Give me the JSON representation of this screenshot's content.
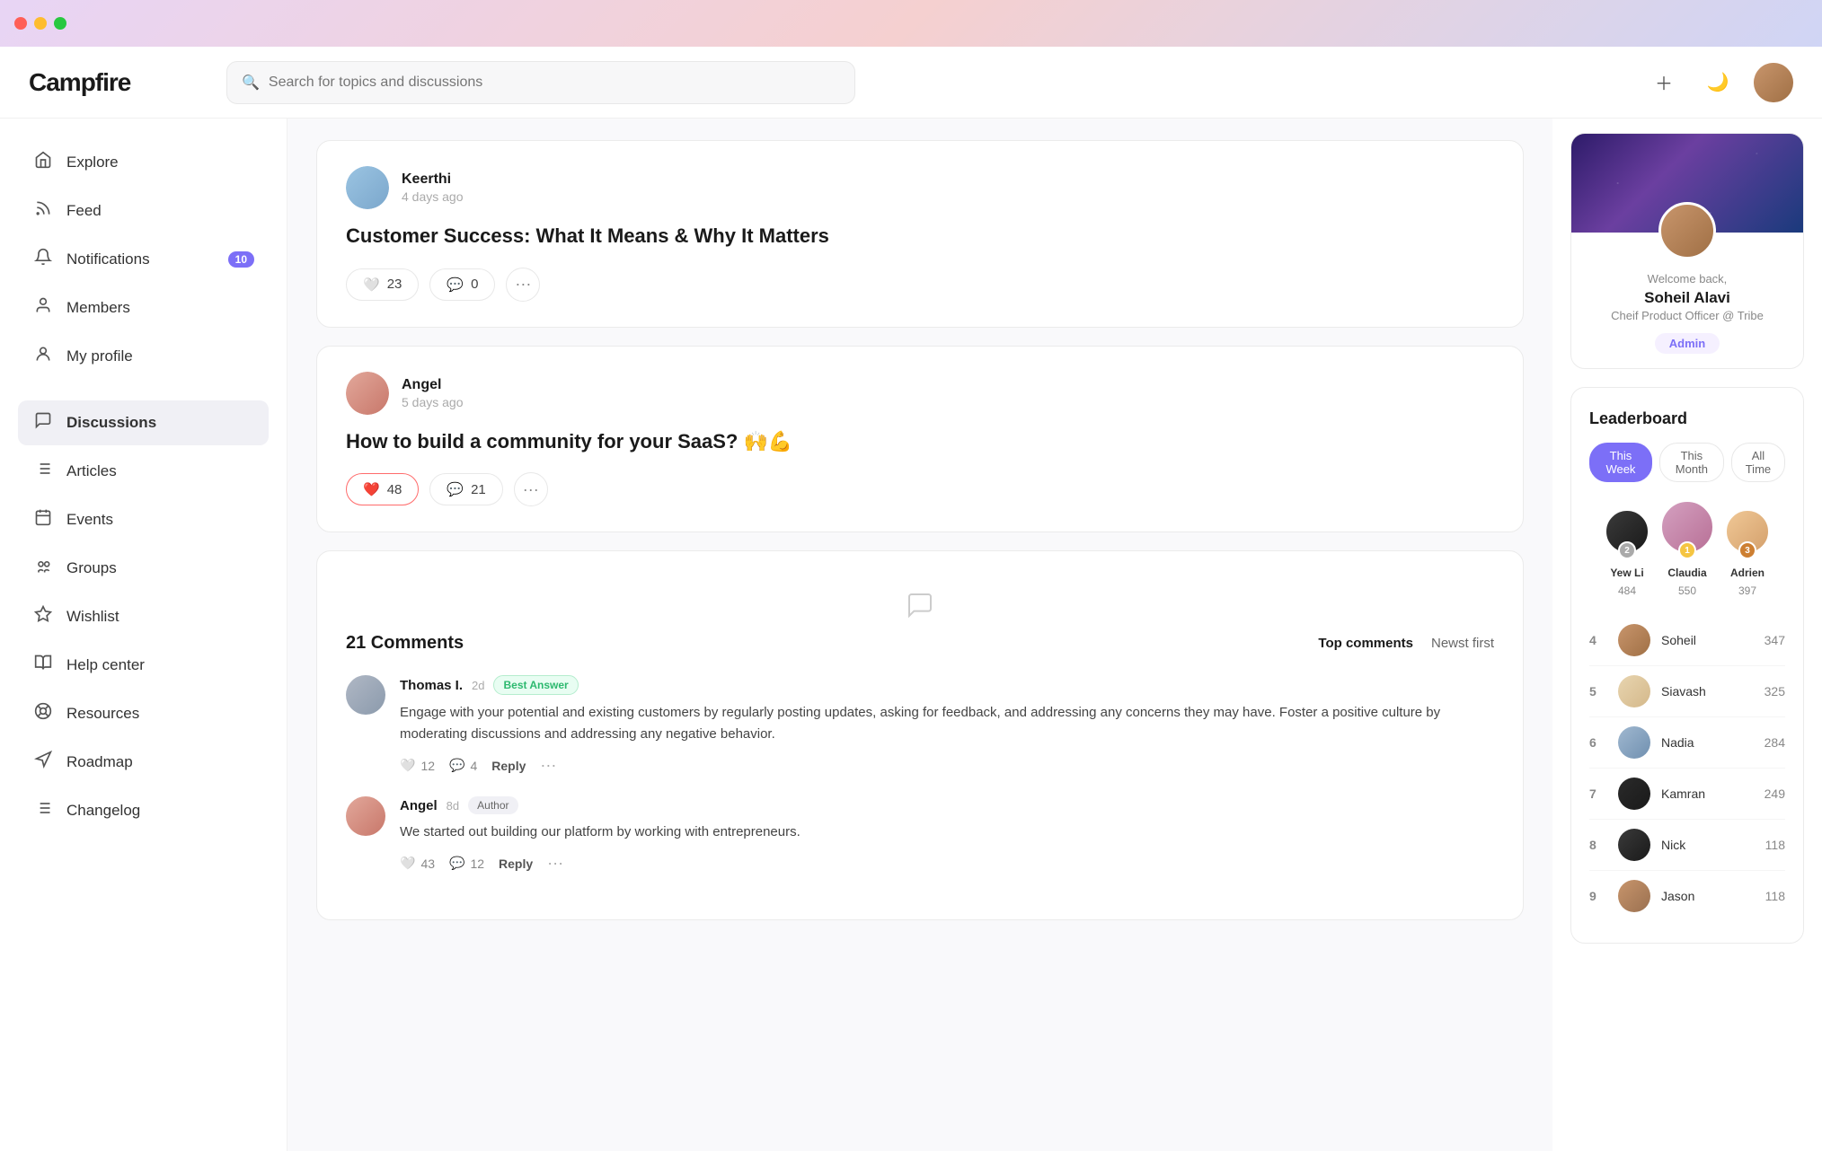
{
  "app": {
    "title": "Campfire",
    "search_placeholder": "Search for topics and discussions"
  },
  "sidebar": {
    "nav_items": [
      {
        "id": "explore",
        "label": "Explore",
        "icon": "🏠"
      },
      {
        "id": "feed",
        "label": "Feed",
        "icon": "📡"
      },
      {
        "id": "notifications",
        "label": "Notifications",
        "icon": "🔔",
        "badge": "10"
      },
      {
        "id": "members",
        "label": "Members",
        "icon": "👤"
      },
      {
        "id": "my-profile",
        "label": "My profile",
        "icon": "👤"
      }
    ],
    "sections": [
      {
        "id": "discussions",
        "label": "Discussions",
        "icon": "💬",
        "active": true
      },
      {
        "id": "articles",
        "label": "Articles",
        "icon": "📋"
      },
      {
        "id": "events",
        "label": "Events",
        "icon": "📅"
      },
      {
        "id": "groups",
        "label": "Groups",
        "icon": "🔗"
      },
      {
        "id": "wishlist",
        "label": "Wishlist",
        "icon": "✨"
      },
      {
        "id": "help-center",
        "label": "Help center",
        "icon": "📖"
      },
      {
        "id": "resources",
        "label": "Resources",
        "icon": "🌐"
      },
      {
        "id": "roadmap",
        "label": "Roadmap",
        "icon": "🗺"
      },
      {
        "id": "changelog",
        "label": "Changelog",
        "icon": "📝"
      }
    ]
  },
  "posts": [
    {
      "id": "post1",
      "author": "Keerthi",
      "time": "4 days ago",
      "title": "Customer Success: What It Means & Why It Matters",
      "likes": 23,
      "comments": 0,
      "liked": false
    },
    {
      "id": "post2",
      "author": "Angel",
      "time": "5 days ago",
      "title": "How to build a community for your SaaS? 🙌💪",
      "likes": 48,
      "comments": 21,
      "liked": true
    }
  ],
  "comments_section": {
    "title": "21 Comments",
    "sort_options": [
      "Top  comments",
      "Newst first"
    ],
    "comments": [
      {
        "id": "c1",
        "author": "Thomas I.",
        "time": "2d",
        "badge": "Best Answer",
        "badge_type": "best",
        "text": "Engage with your potential and existing customers by regularly posting updates, asking for feedback, and addressing any concerns they may have. Foster a positive culture by moderating discussions and addressing any negative behavior.",
        "likes": 12,
        "replies": 4
      },
      {
        "id": "c2",
        "author": "Angel",
        "time": "8d",
        "badge": "Author",
        "badge_type": "author",
        "text": "We started out building our platform by working with entrepreneurs.",
        "likes": 43,
        "replies": 12
      }
    ]
  },
  "profile_card": {
    "welcome": "Welcome back,",
    "name": "Soheil Alavi",
    "title": "Cheif Product Officer @ Tribe",
    "badge": "Admin"
  },
  "leaderboard": {
    "title": "Leaderboard",
    "tabs": [
      "This Week",
      "This Month",
      "All Time"
    ],
    "active_tab": "This Week",
    "top3": [
      {
        "rank": 2,
        "name": "Yew Li",
        "score": 484
      },
      {
        "rank": 1,
        "name": "Claudia",
        "score": 550
      },
      {
        "rank": 3,
        "name": "Adrien",
        "score": 397
      }
    ],
    "rows": [
      {
        "rank": 4,
        "name": "Soheil",
        "score": 347
      },
      {
        "rank": 5,
        "name": "Siavash",
        "score": 325
      },
      {
        "rank": 6,
        "name": "Nadia",
        "score": 284
      },
      {
        "rank": 7,
        "name": "Kamran",
        "score": 249
      },
      {
        "rank": 8,
        "name": "Nick",
        "score": 118
      },
      {
        "rank": 9,
        "name": "Jason",
        "score": 118
      }
    ]
  }
}
